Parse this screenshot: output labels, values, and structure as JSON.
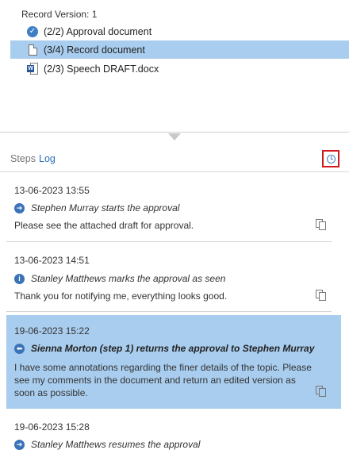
{
  "records": {
    "version_label": "Record Version: 1",
    "items": [
      {
        "label": "(2/2) Approval document",
        "icon": "check-circle-icon",
        "selected": false
      },
      {
        "label": "(3/4) Record document",
        "icon": "document-icon",
        "selected": true
      },
      {
        "label": "(2/3) Speech DRAFT.docx",
        "icon": "word-doc-icon",
        "selected": false
      }
    ]
  },
  "tabs": {
    "steps": "Steps",
    "log": "Log"
  },
  "colors": {
    "selected_bg": "#a9cdee",
    "accent": "#2a6ebb",
    "highlight_border": "#d0191f"
  },
  "log": [
    {
      "date": "13-06-2023 13:55",
      "action": "Stephen Murray starts the approval",
      "icon": "arrow-right-circle-icon",
      "message": "Please see the attached draft for approval."
    },
    {
      "date": "13-06-2023 14:51",
      "action": "Stanley Matthews marks the approval as seen",
      "icon": "info-circle-icon",
      "message": "Thank you for notifying me, everything looks good."
    },
    {
      "date": "19-06-2023 15:22",
      "action": "Sienna Morton (step 1) returns the approval to Stephen Murray",
      "icon": "arrow-left-circle-icon",
      "message": "I have some annotations regarding the finer details of the topic. Please see my comments in the document and return an edited version as soon as possible."
    },
    {
      "date": "19-06-2023 15:28",
      "action": "Stanley Matthews resumes the approval",
      "icon": "arrow-right-circle-icon",
      "message": ""
    }
  ]
}
